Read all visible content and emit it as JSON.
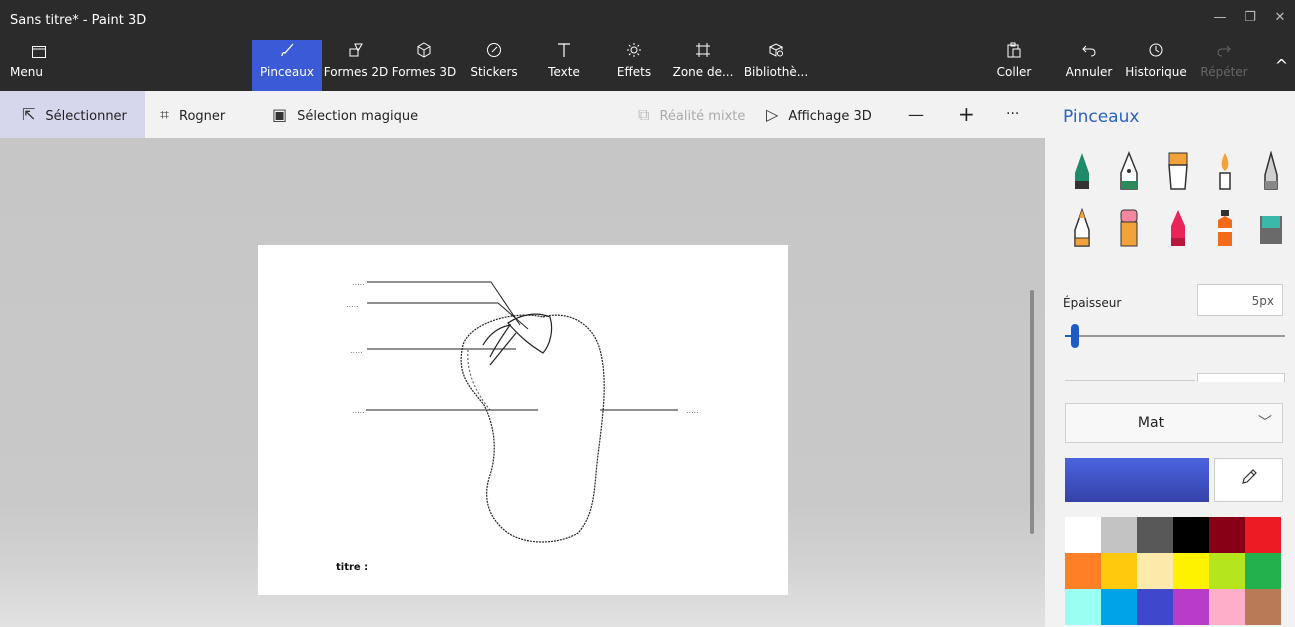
{
  "window": {
    "title": "Sans titre* - Paint 3D",
    "minimize": "—",
    "restore": "❐",
    "close": "✕"
  },
  "toolbar": {
    "menu": {
      "icon": "folder-icon",
      "label": "Menu"
    },
    "tools": [
      {
        "icon": "brush-icon",
        "label": "Pinceaux",
        "active": true
      },
      {
        "icon": "2d-shapes-icon",
        "label": "Formes 2D"
      },
      {
        "icon": "3d-shapes-icon",
        "label": "Formes 3D"
      },
      {
        "icon": "stickers-icon",
        "label": "Stickers"
      },
      {
        "icon": "text-icon",
        "label": "Texte"
      },
      {
        "icon": "effects-icon",
        "label": "Effets"
      },
      {
        "icon": "canvas-icon",
        "label": "Zone de..."
      },
      {
        "icon": "library-icon",
        "label": "Bibliothè..."
      }
    ],
    "paste": {
      "icon": "paste-icon",
      "label": "Coller"
    },
    "undo": {
      "icon": "undo-icon",
      "label": "Annuler"
    },
    "history": {
      "icon": "history-icon",
      "label": "Historique"
    },
    "redo": {
      "icon": "redo-icon",
      "label": "Répéter"
    },
    "collapse": "^"
  },
  "subbar": {
    "select": "Sélectionner",
    "crop": "Rogner",
    "magic_select": "Sélection magique",
    "mixed_reality": "Réalité mixte",
    "view3d": "Affichage 3D",
    "zoom_out": "—",
    "zoom_in": "+",
    "more": "···"
  },
  "canvas": {
    "caption": "titre :",
    "label_placeholder": "....."
  },
  "panel": {
    "title": "Pinceaux",
    "brushes": [
      "marker-icon",
      "calligraphy-pen-icon",
      "oil-brush-icon",
      "watercolor-icon",
      "pixel-pen-icon",
      "pencil-icon",
      "eraser-icon",
      "crayon-icon",
      "spray-can-icon",
      "fill-bucket-icon"
    ],
    "thickness_label": "Épaisseur",
    "thickness_value": "5px",
    "thickness_fraction": 0.05,
    "material": "Mat",
    "material_chevron": "﹀",
    "current_color": "#4a5ad8",
    "eyedropper_icon": "eyedropper-icon",
    "palette": [
      "#ffffff",
      "#c3c3c3",
      "#585858",
      "#000000",
      "#880015",
      "#ed1c24",
      "#ff7f27",
      "#ffc90e",
      "#fde9a9",
      "#fff200",
      "#b5e61d",
      "#22b14c",
      "#99fff3",
      "#00a2e8",
      "#3f48cc",
      "#b93cc9",
      "#ffaec9",
      "#b97a57"
    ]
  }
}
